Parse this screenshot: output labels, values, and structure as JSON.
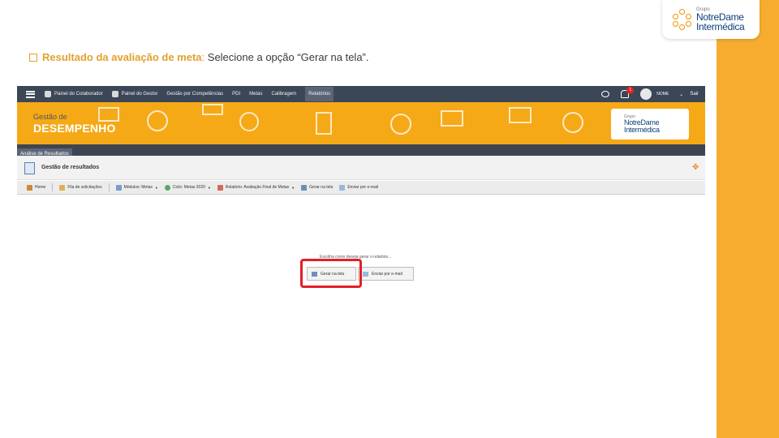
{
  "logo": {
    "small": "Grupo",
    "line1": "NotreDame",
    "line2": "Intermédica"
  },
  "instruction": {
    "bold": "Resultado da avaliação de meta",
    "colon": ":",
    "rest": " Selecione a opção “Gerar na tela”."
  },
  "app": {
    "nav": [
      "Painel do Colaborador",
      "Painel do Gestor",
      "Gestão por Competências",
      "PDI",
      "Metas",
      "Calibragem",
      "Relatórios"
    ],
    "notifications": "1",
    "username": "NOME",
    "logout": "Sair",
    "banner_small": "Gestão de",
    "banner_big": "DESEMPENHO",
    "breadcrumb": "Análise de Resultados",
    "page_title": "Gestão de resultados",
    "toolbar": [
      "Home",
      "Fila de solicitações",
      "Módulos: Metas",
      "Ciclo: Metas 2020",
      "Relatório: Avaliação Final de Metas",
      "Gerar na tela",
      "Enviar por e-mail"
    ]
  },
  "dialog": {
    "prompt": "Escolha como deseja gerar o relatório...",
    "gerar_na_tela": "Gerar na tela",
    "enviar_por_email": "Enviar por e-mail"
  },
  "colors": {
    "accent": "#f6ad2f",
    "banner": "#f5a917",
    "highlight": "#e41e26",
    "nav": "#3b4657"
  }
}
